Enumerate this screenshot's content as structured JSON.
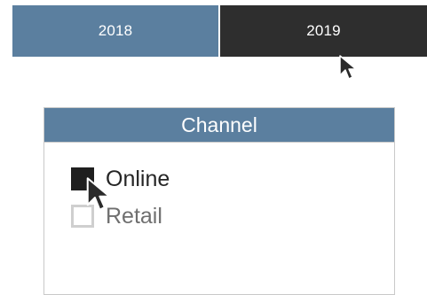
{
  "year_slicer": {
    "items": [
      {
        "label": "2018",
        "selected": false,
        "background": "#5b7f9f"
      },
      {
        "label": "2019",
        "selected": true,
        "background": "#2e2e2e"
      }
    ]
  },
  "channel_slicer": {
    "title": "Channel",
    "header_color": "#5b7f9f",
    "options": [
      {
        "label": "Online",
        "checked": true
      },
      {
        "label": "Retail",
        "checked": false
      }
    ]
  },
  "icons": {
    "cursor": "mouse-pointer-icon"
  }
}
